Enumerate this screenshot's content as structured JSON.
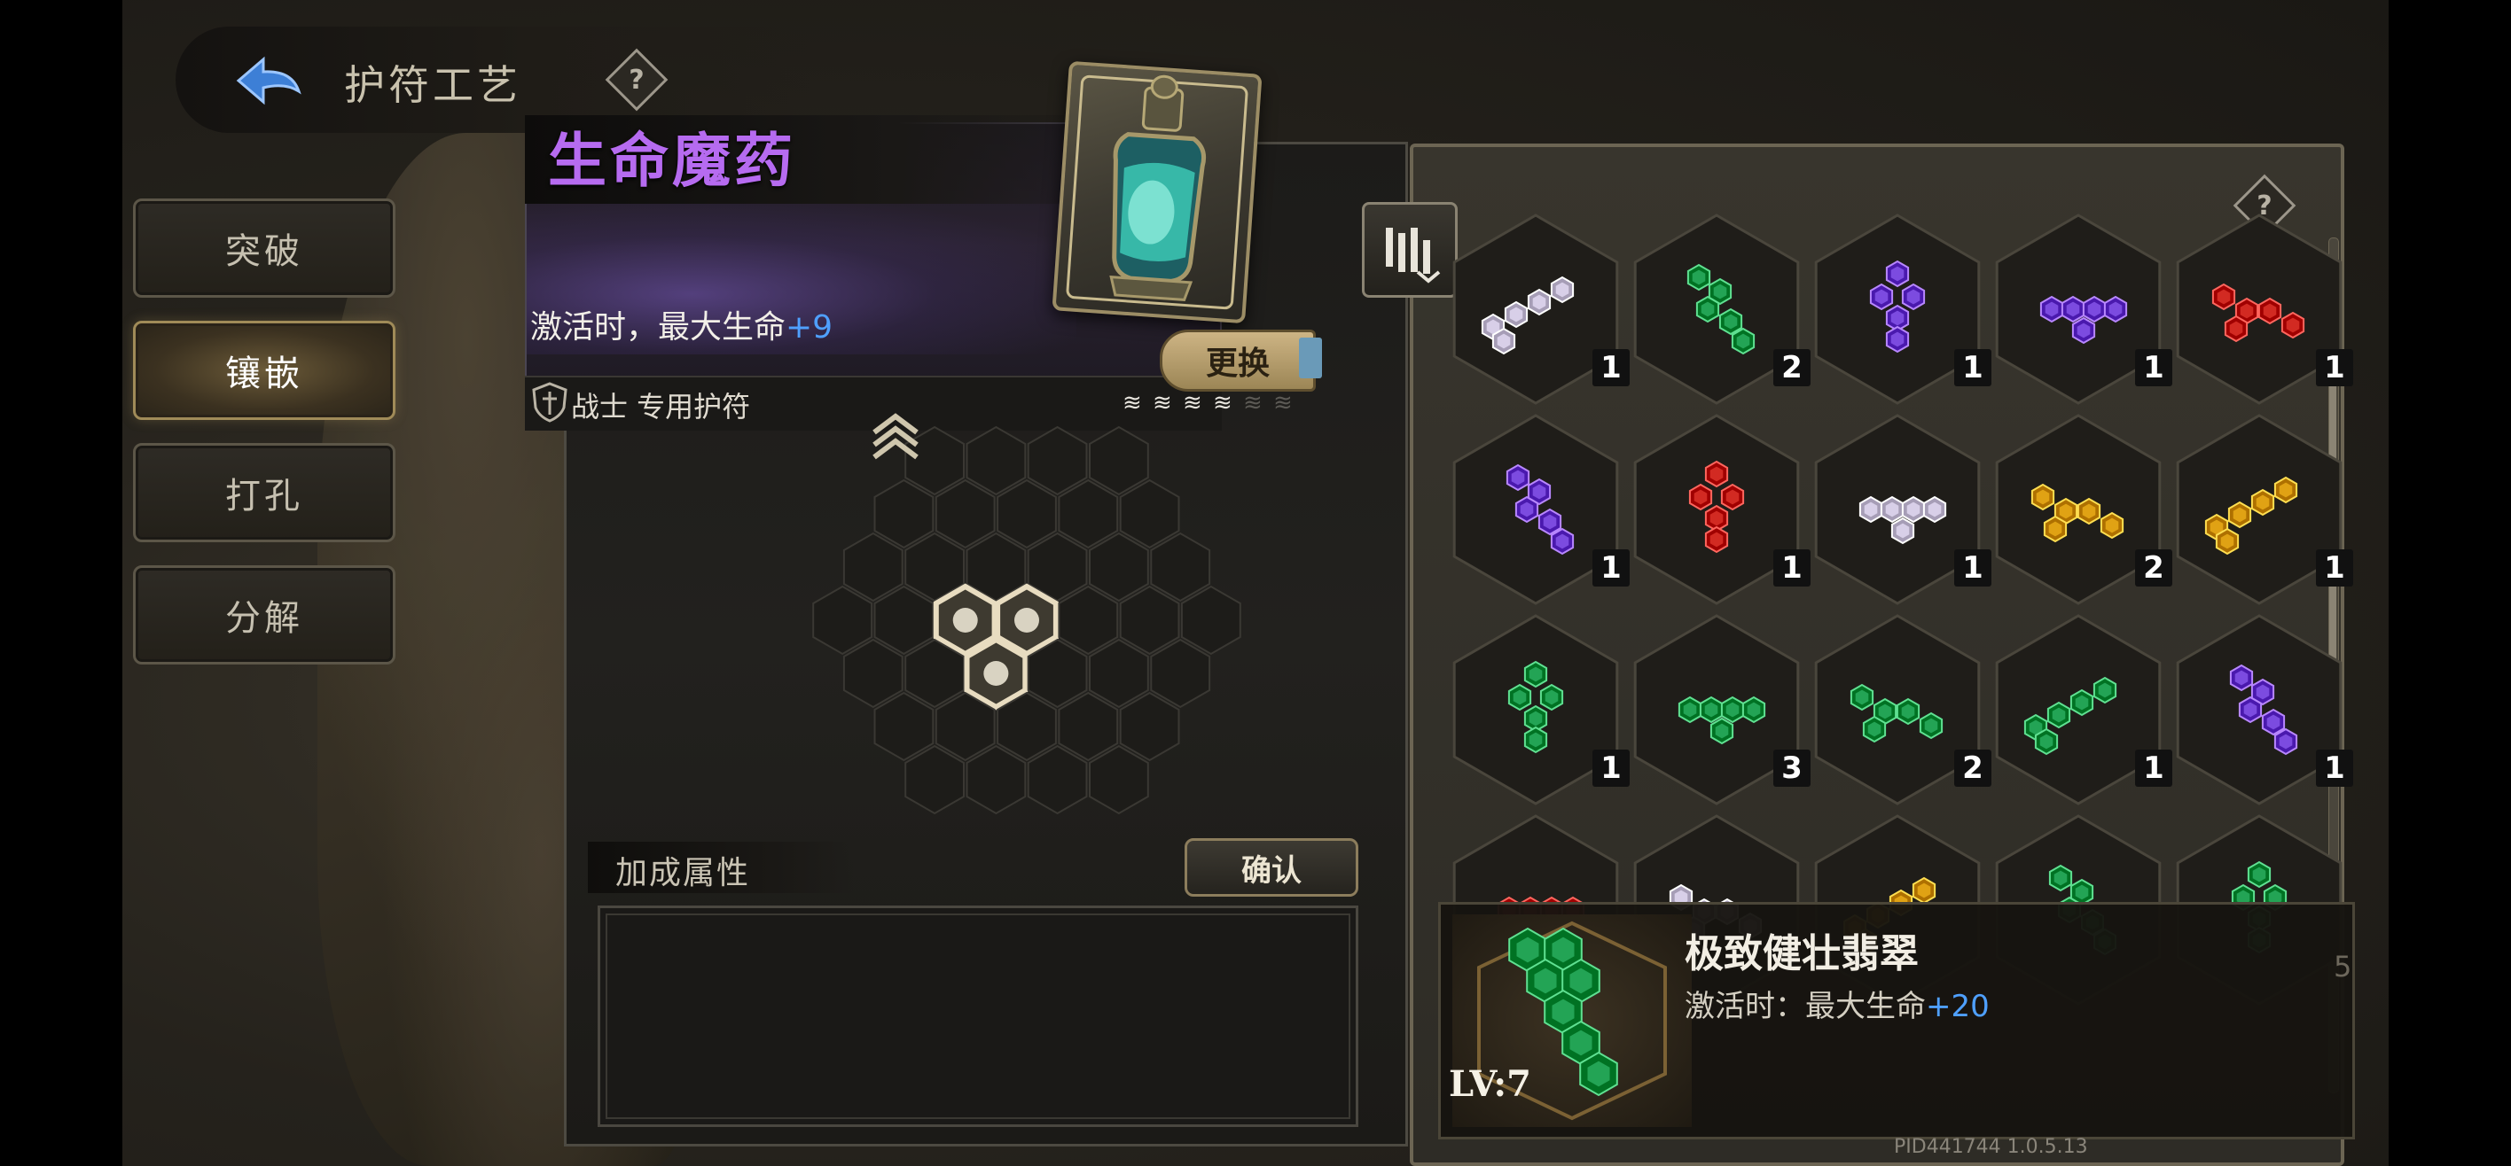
{
  "header": {
    "title": "护符工艺",
    "back_icon": "back-arrow-icon",
    "help_icon": "help-icon"
  },
  "menu": [
    {
      "label": "突破",
      "active": false
    },
    {
      "label": "镶嵌",
      "active": true
    },
    {
      "label": "打孔",
      "active": false
    },
    {
      "label": "分解",
      "active": false
    }
  ],
  "charm": {
    "name": "生命魔药",
    "effect_label": "激活时，最大生命",
    "effect_value": "+9",
    "class_label": "战士 专用护符",
    "rank_total": 6,
    "rank_filled": 4,
    "swap_label": "更换",
    "name_color": "#b66bf0"
  },
  "board": {
    "title": "加成属性",
    "confirm_label": "确认"
  },
  "gems": {
    "rows": [
      [
        {
          "color": "#d8cfe8",
          "count": "1"
        },
        {
          "color": "#23a455",
          "count": "2"
        },
        {
          "color": "#7c4be0",
          "count": "1"
        },
        {
          "color": "#7c4be0",
          "count": "1"
        },
        {
          "color": "#d22a22",
          "count": "1"
        }
      ],
      [
        {
          "color": "#7c4be0",
          "count": "1"
        },
        {
          "color": "#d22a22",
          "count": "1"
        },
        {
          "color": "#d8cfe8",
          "count": "1"
        },
        {
          "color": "#e0a214",
          "count": "2"
        },
        {
          "color": "#e0a214",
          "count": "1"
        }
      ],
      [
        {
          "color": "#23a455",
          "count": "1"
        },
        {
          "color": "#23a455",
          "count": "3"
        },
        {
          "color": "#23a455",
          "count": "2"
        },
        {
          "color": "#23a455",
          "count": "1"
        },
        {
          "color": "#7c4be0",
          "count": "1"
        }
      ],
      [
        {
          "color": "#d22a22",
          "count": ""
        },
        {
          "color": "#d8cfe8",
          "count": ""
        },
        {
          "color": "#e0a214",
          "count": ""
        },
        {
          "color": "#23a455",
          "count": ""
        },
        {
          "color": "#23a455",
          "count": ""
        }
      ]
    ]
  },
  "detail": {
    "name": "极致健壮翡翠",
    "effect_label": "激活时：最大生命",
    "effect_value": "+20",
    "level": "LV:7",
    "side_num": "5"
  },
  "footer": {
    "version": "PID441744  1.0.5.13"
  }
}
